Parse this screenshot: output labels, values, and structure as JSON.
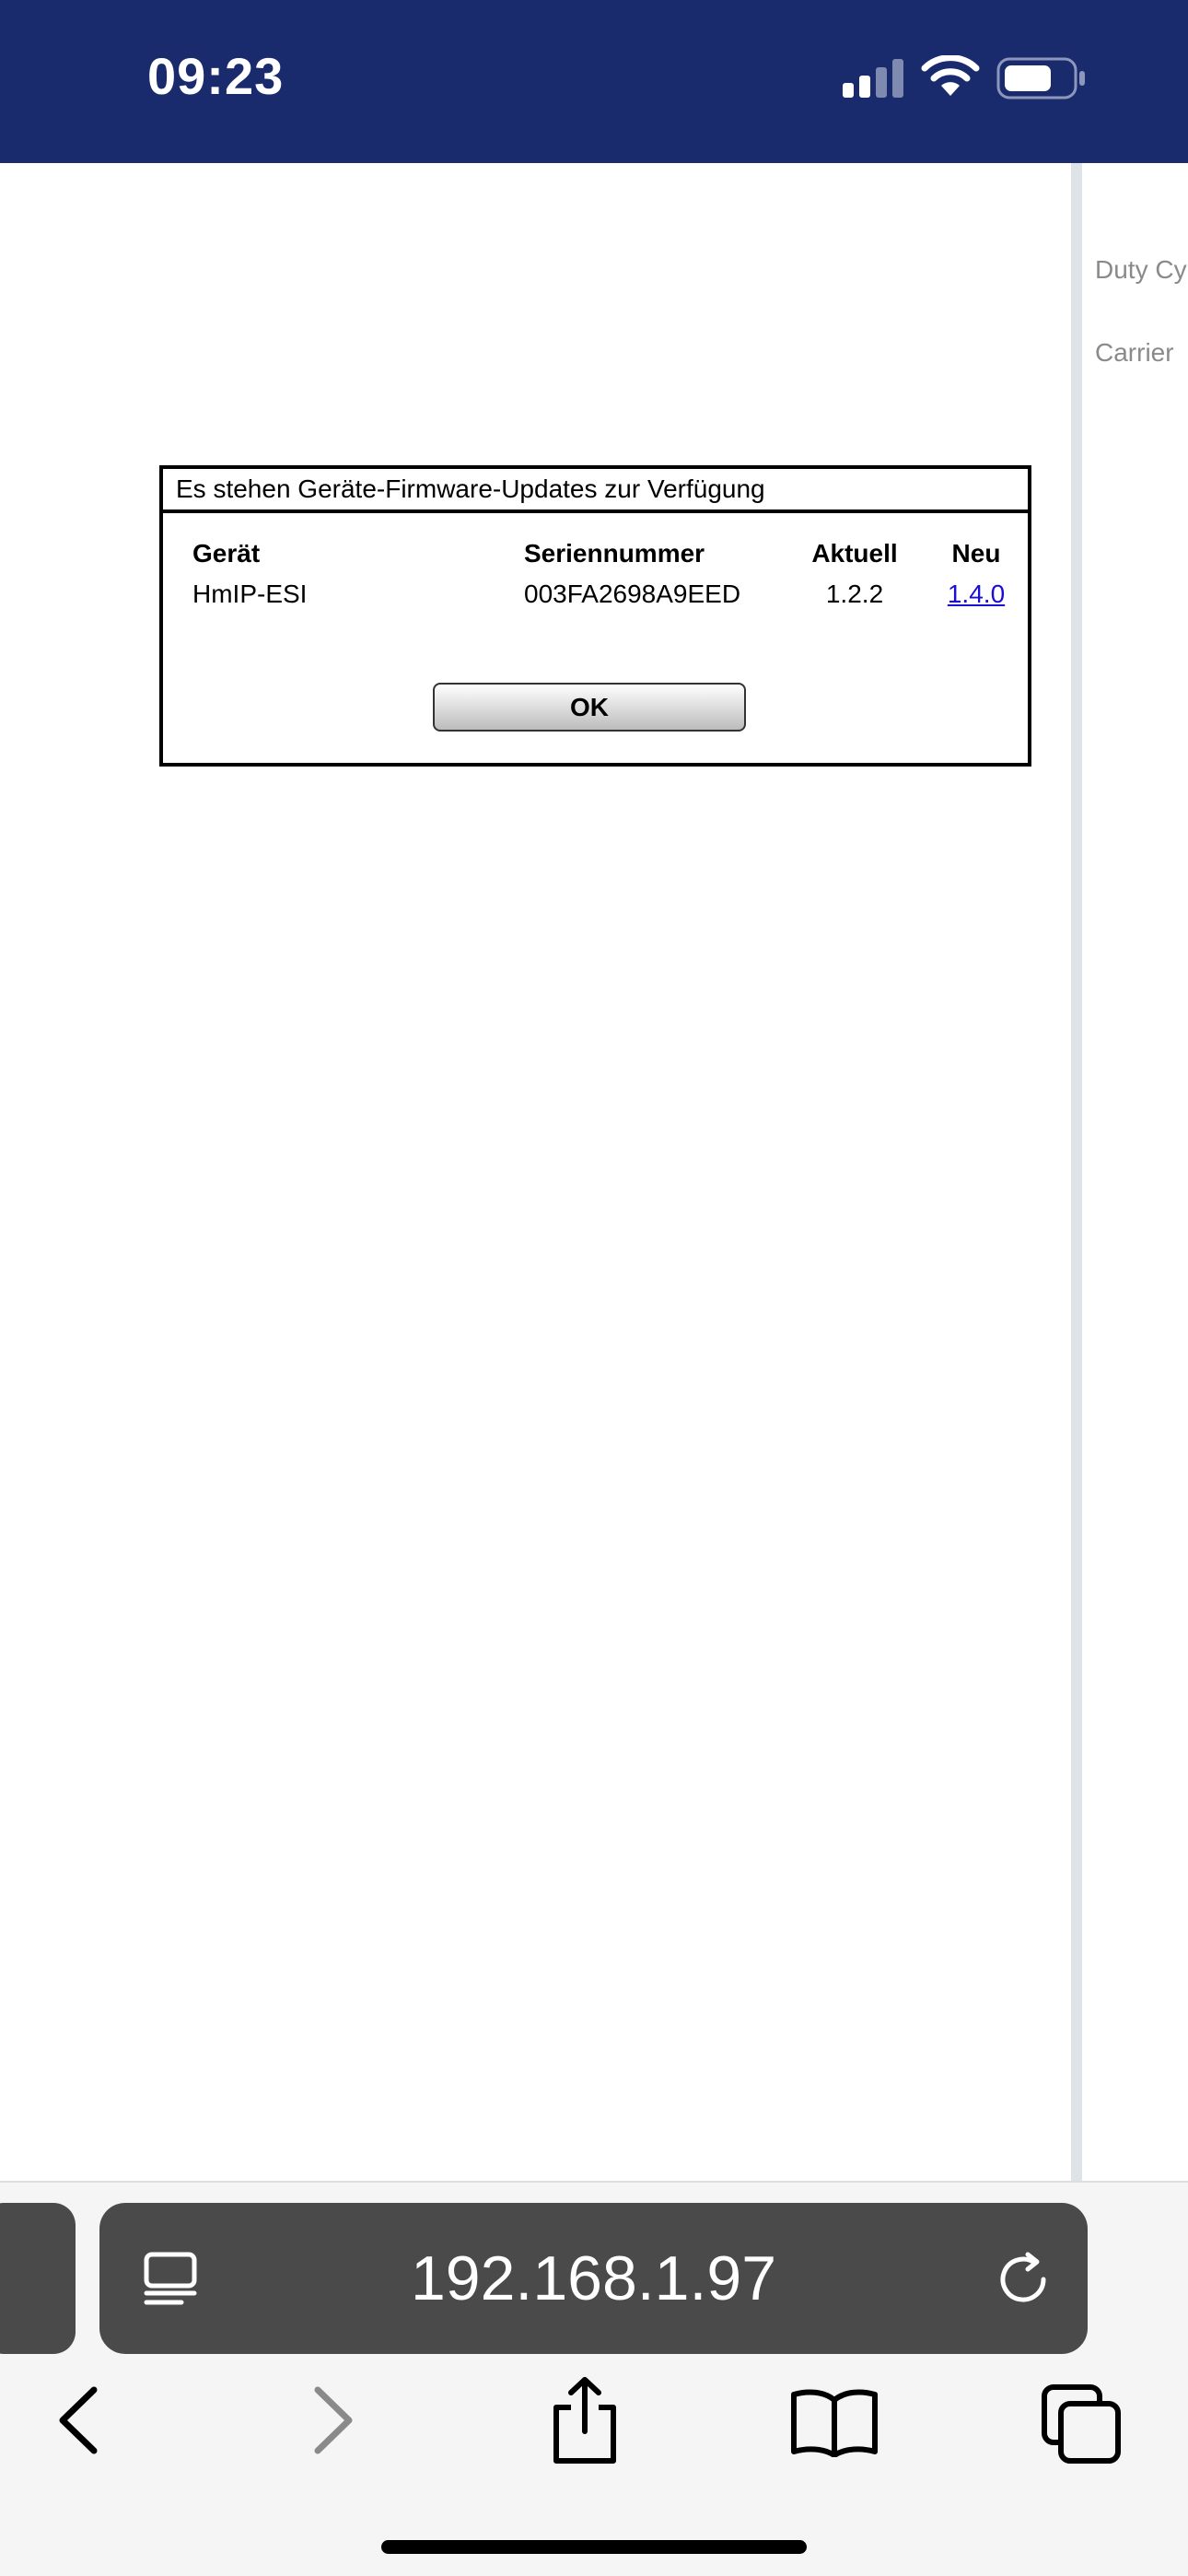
{
  "status_bar": {
    "time": "09:23",
    "icons": [
      "signal-icon",
      "wifi-icon",
      "battery-icon"
    ]
  },
  "page": {
    "side_labels": [
      "Duty Cy",
      "Carrier"
    ]
  },
  "dialog": {
    "title": "Es stehen Geräte-Firmware-Updates zur Verfügung",
    "table": {
      "headers": [
        "Gerät",
        "Seriennummer",
        "Aktuell",
        "Neu"
      ],
      "rows": [
        {
          "device": "HmIP-ESI",
          "serial": "003FA2698A9EED",
          "current": "1.2.2",
          "new": "1.4.0"
        }
      ]
    },
    "ok_label": "OK"
  },
  "browser": {
    "address": "192.168.1.97",
    "icons": [
      "reader-icon",
      "reload-icon",
      "back-icon",
      "forward-icon",
      "share-icon",
      "bookmarks-icon",
      "tabs-icon"
    ]
  },
  "colors": {
    "status_bar": "#1a2b6d",
    "link": "#1a0dd4",
    "address_bar": "#4a4a4a"
  }
}
